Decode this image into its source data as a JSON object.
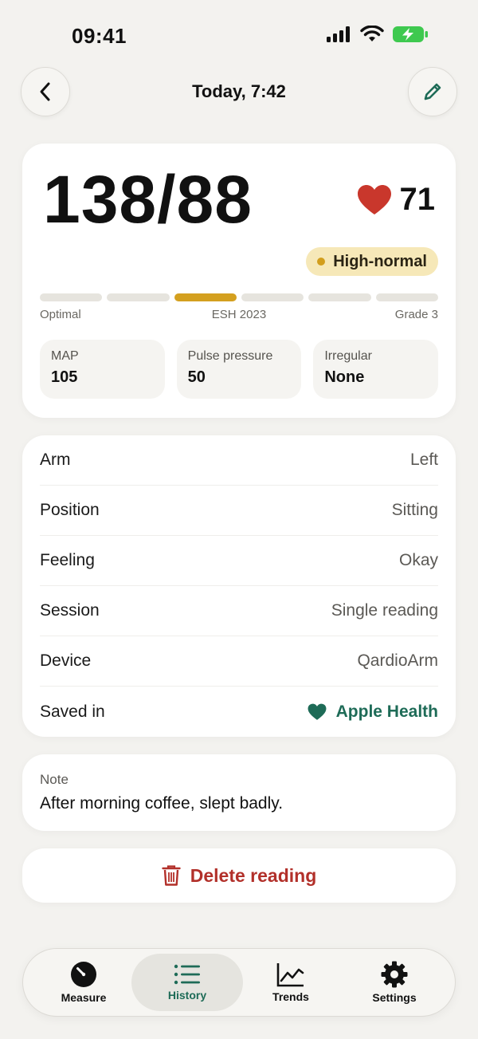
{
  "status_bar": {
    "time": "09:41"
  },
  "nav": {
    "title": "Today, 7:42"
  },
  "reading": {
    "bp": "138/88",
    "pulse": "71",
    "category": "High-normal",
    "scale": {
      "segments": 6,
      "active_index": 2,
      "left_label": "Optimal",
      "center_label": "ESH 2023",
      "right_label": "Grade 3"
    },
    "stats": [
      {
        "label": "MAP",
        "value": "105"
      },
      {
        "label": "Pulse pressure",
        "value": "50"
      },
      {
        "label": "Irregular",
        "value": "None"
      }
    ]
  },
  "details": [
    {
      "label": "Arm",
      "value": "Left"
    },
    {
      "label": "Position",
      "value": "Sitting"
    },
    {
      "label": "Feeling",
      "value": "Okay"
    },
    {
      "label": "Session",
      "value": "Single reading"
    },
    {
      "label": "Device",
      "value": "QardioArm"
    },
    {
      "label": "Saved in",
      "value": "Apple Health"
    }
  ],
  "note": {
    "label": "Note",
    "text": "After morning coffee, slept badly."
  },
  "delete": {
    "label": "Delete reading"
  },
  "tabs": [
    {
      "label": "Measure",
      "icon": "gauge-icon"
    },
    {
      "label": "History",
      "icon": "list-icon",
      "active": true
    },
    {
      "label": "Trends",
      "icon": "chart-icon"
    },
    {
      "label": "Settings",
      "icon": "gear-icon"
    }
  ],
  "colors": {
    "accent_green": "#1e6b57",
    "category_yellow": "#d4a01f",
    "heart_red": "#c9372c",
    "delete_red": "#b2302a"
  }
}
